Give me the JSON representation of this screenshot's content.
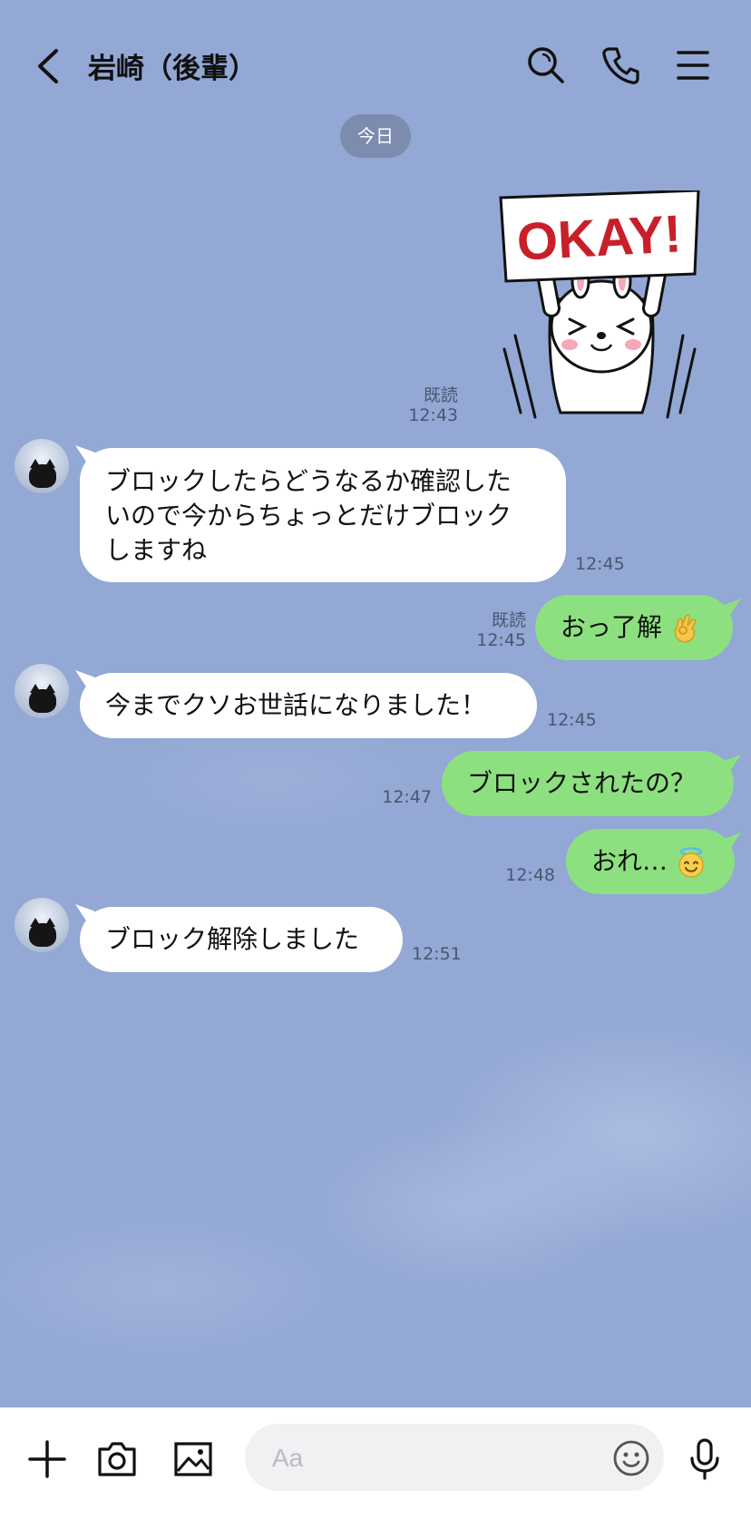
{
  "header": {
    "title": "岩崎（後輩）"
  },
  "date_chip": "今日",
  "sticker": {
    "text": "OKAY!",
    "read": "既読",
    "time": "12:43"
  },
  "messages": [
    {
      "lines": [
        "ブロックしたらどうなるか確認した",
        "いので今からちょっとだけブロック",
        "しますね"
      ],
      "time": "12:45"
    },
    {
      "text": "おっ了解",
      "read": "既読",
      "time": "12:45"
    },
    {
      "text": "今までクソお世話になりました！",
      "time": "12:45"
    },
    {
      "text": "ブロックされたの？",
      "time": "12:47"
    },
    {
      "text": "おれ…",
      "time": "12:48"
    },
    {
      "text": "ブロック解除しました",
      "time": "12:51"
    }
  ],
  "input": {
    "placeholder": "Aa"
  },
  "colors": {
    "background": "#93a8d4",
    "incoming_bubble": "#ffffff",
    "outgoing_bubble": "#8de07f",
    "date_chip": "#7b8cae",
    "sticker_text": "#c8202a"
  },
  "icons": [
    "back-icon",
    "search-icon",
    "phone-icon",
    "menu-icon",
    "plus-icon",
    "camera-icon",
    "image-icon",
    "smile-icon",
    "mic-icon",
    "ok-hand-emoji",
    "halo-smile-emoji"
  ]
}
